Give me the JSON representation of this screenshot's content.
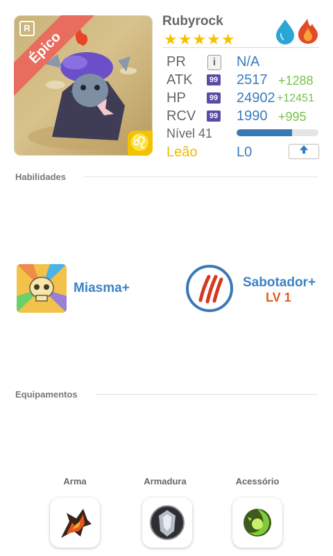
{
  "monster": {
    "name": "Rubyrock",
    "stars": "★★★★★",
    "rarity": "Épico",
    "sign_name": "Leão",
    "sign_symbol": "♌",
    "collection_badge": "R",
    "elements": [
      "water-drop-icon",
      "fire-icon"
    ]
  },
  "stats": {
    "pr": {
      "label": "PR",
      "value": "N/A",
      "info": "i"
    },
    "atk": {
      "label": "ATK",
      "badge": "99",
      "value": "2517",
      "bonus": "+1288"
    },
    "hp": {
      "label": "HP",
      "badge": "99",
      "value": "24902",
      "bonus": "+12451"
    },
    "rcv": {
      "label": "RCV",
      "badge": "99",
      "value": "1990",
      "bonus": "+995"
    },
    "level": {
      "label": "Nível 41",
      "progress": 0.68
    },
    "rank": {
      "value": "L0"
    }
  },
  "sections": {
    "skills_title": "Habilidades",
    "equipment_title": "Equipamentos"
  },
  "skills": [
    {
      "name": "Miasma+",
      "icon": "skull-icon"
    },
    {
      "name": "Sabotador+",
      "level": "LV 1",
      "icon": "claw-scratch-icon"
    }
  ],
  "equipment": [
    {
      "label": "Arma",
      "icon": "weapon-icon"
    },
    {
      "label": "Armadura",
      "icon": "armor-icon"
    },
    {
      "label": "Acessório",
      "icon": "accessory-icon"
    }
  ],
  "colors": {
    "value_blue": "#3a7bbf",
    "bonus_green": "#77c24a",
    "rarity_red": "#e86d5e",
    "sign_yellow": "#f2c300",
    "level_orange": "#e85a1d"
  }
}
